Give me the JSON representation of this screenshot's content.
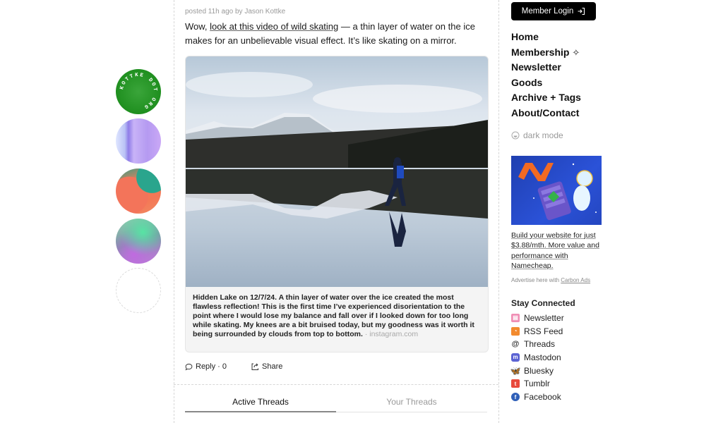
{
  "post": {
    "meta": "posted 11h ago by Jason Kottke",
    "lede_prefix": "Wow, ",
    "lede_link": "look at this video of wild skating",
    "lede_suffix": " — a thin layer of water on the ice makes for an unbelievable visual effect. It’s like skating on a mirror.",
    "caption": "Hidden Lake on 12/7/24. A thin layer of water over the ice created the most flawless reflection! This is the first time I’ve experienced disorientation to the point where I would lose my balance and fall over if I looked down for too long while skating. My knees are a bit bruised today, but my goodness was it worth it being surrounded by clouds from top to bottom.",
    "caption_source": " · instagram.com",
    "photo_alt": "Skater standing on mirror-like frozen lake reflecting snowy mountains"
  },
  "actions": {
    "reply_label": "Reply · 0",
    "share_label": "Share"
  },
  "tabs": [
    {
      "label": "Active Threads",
      "active": true
    },
    {
      "label": "Your Threads",
      "active": false
    }
  ],
  "logo": {
    "text": "KOTTKE DOT ORG"
  },
  "sidebar": {
    "login_label": "Member Login",
    "nav": [
      "Home",
      "Membership",
      "Newsletter",
      "Goods",
      "Archive + Tags",
      "About/Contact"
    ],
    "dark_mode_label": "dark mode",
    "ad_text": "Build your website for just $3.88/mth. More value and performance with Namecheap.",
    "ad_footer_prefix": "Advertise here with ",
    "ad_footer_link": "Carbon Ads",
    "stay_connected": "Stay Connected",
    "social": [
      {
        "label": "Newsletter",
        "icon": "newsletter-icon",
        "color": "#f08fb5"
      },
      {
        "label": "RSS Feed",
        "icon": "rss-icon",
        "color": "#f28a2e"
      },
      {
        "label": "Threads",
        "icon": "threads-icon",
        "color": "#333333"
      },
      {
        "label": "Mastodon",
        "icon": "mastodon-icon",
        "color": "#5b63d3"
      },
      {
        "label": "Bluesky",
        "icon": "bluesky-icon",
        "color": "#1f8cf0"
      },
      {
        "label": "Tumblr",
        "icon": "tumblr-icon",
        "color": "#e8493b"
      },
      {
        "label": "Facebook",
        "icon": "facebook-icon",
        "color": "#2f5fb8"
      }
    ]
  }
}
